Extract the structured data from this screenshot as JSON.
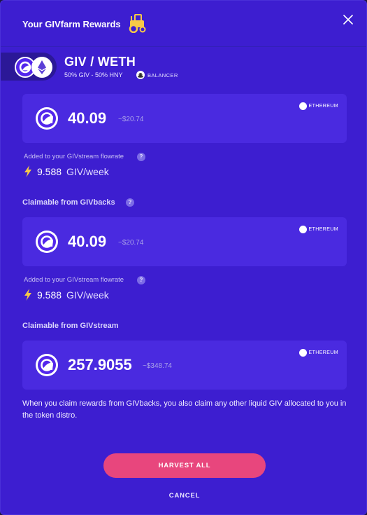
{
  "modal": {
    "title": "Your GIVfarm Rewards"
  },
  "pair": {
    "name": "GIV / WETH",
    "composition": "50% GIV - 50% HNY",
    "platform": "BALANCER"
  },
  "cards": [
    {
      "amount": "40.09",
      "usd": "~$20.74",
      "chain": "ETHEREUM"
    },
    {
      "amount": "40.09",
      "usd": "~$20.74",
      "chain": "ETHEREUM"
    },
    {
      "amount": "257.9055",
      "usd": "~$348.74",
      "chain": "ETHEREUM"
    }
  ],
  "flowrates": [
    {
      "label": "Added to your GIVstream flowrate",
      "value": "9.588",
      "unit": "GIV/week"
    },
    {
      "label": "Added to your GIVstream flowrate",
      "value": "9.588",
      "unit": "GIV/week"
    }
  ],
  "sections": {
    "givbacks": "Claimable from  GIVbacks",
    "givstream": "Claimable from  GIVstream"
  },
  "note": "When you claim rewards from GIVbacks, you also claim any other liquid GIV allocated to you in the token distro.",
  "buttons": {
    "harvest": "HARVEST ALL",
    "cancel": "CANCEL"
  },
  "help_glyph": "?",
  "colors": {
    "modal_bg": "#3d1ed0",
    "card_bg": "#4a2ae0",
    "accent": "#e8467d",
    "bolt": "#f7c948"
  }
}
